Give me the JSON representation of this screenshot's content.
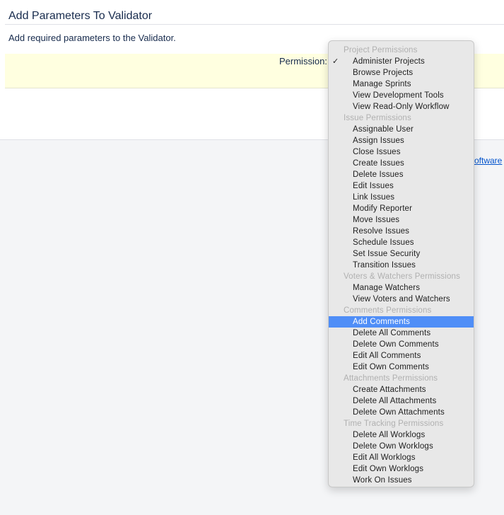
{
  "page": {
    "title": "Add Parameters To Validator",
    "description": "Add required parameters to the Validator.",
    "permission_label": "Permission:",
    "footer_link_fragment": "oftware"
  },
  "dropdown": {
    "checked_item": "Administer Projects",
    "highlighted_item": "Add Comments",
    "groups": [
      {
        "label": "Project Permissions",
        "items": [
          "Administer Projects",
          "Browse Projects",
          "Manage Sprints",
          "View Development Tools",
          "View Read-Only Workflow"
        ]
      },
      {
        "label": "Issue Permissions",
        "items": [
          "Assignable User",
          "Assign Issues",
          "Close Issues",
          "Create Issues",
          "Delete Issues",
          "Edit Issues",
          "Link Issues",
          "Modify Reporter",
          "Move Issues",
          "Resolve Issues",
          "Schedule Issues",
          "Set Issue Security",
          "Transition Issues"
        ]
      },
      {
        "label": "Voters & Watchers Permissions",
        "items": [
          "Manage Watchers",
          "View Voters and Watchers"
        ]
      },
      {
        "label": "Comments Permissions",
        "items": [
          "Add Comments",
          "Delete All Comments",
          "Delete Own Comments",
          "Edit All Comments",
          "Edit Own Comments"
        ]
      },
      {
        "label": "Attachments Permissions",
        "items": [
          "Create Attachments",
          "Delete All Attachments",
          "Delete Own Attachments"
        ]
      },
      {
        "label": "Time Tracking Permissions",
        "items": [
          "Delete All Worklogs",
          "Delete Own Worklogs",
          "Edit All Worklogs",
          "Edit Own Worklogs",
          "Work On Issues"
        ]
      }
    ]
  }
}
